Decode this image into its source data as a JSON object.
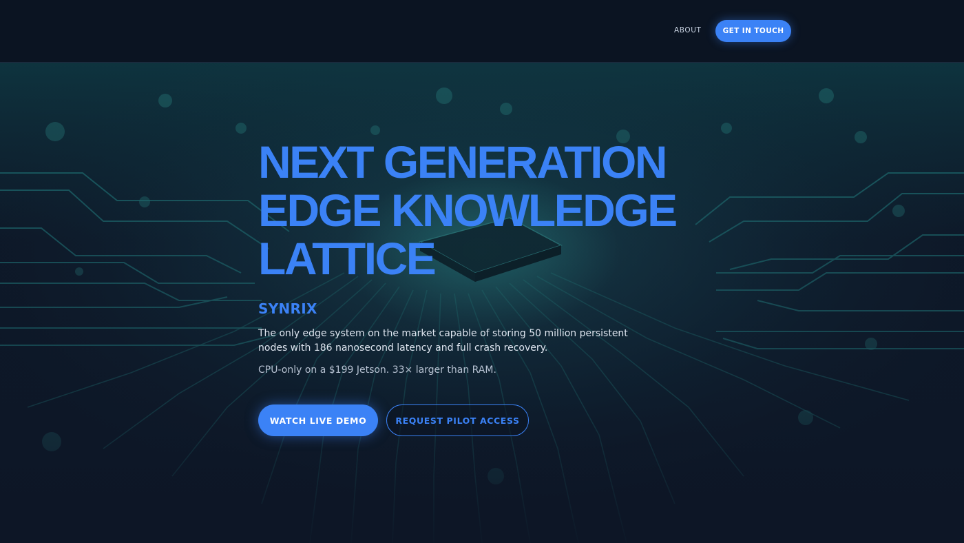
{
  "nav": {
    "about_label": "ABOUT",
    "cta_label": "GET IN TOUCH"
  },
  "hero": {
    "headline_lines": [
      "NEXT GENERATION",
      "EDGE KNOWLEDGE",
      "LATTICE"
    ],
    "brand": "SYNRIX",
    "description": "The only edge system on the market capable of storing 50 million persistent nodes with 186 nanosecond latency and full crash recovery.",
    "subtext": "CPU-only on a $199 Jetson. 33× larger than RAM.",
    "primary_button": "WATCH LIVE DEMO",
    "secondary_button": "REQUEST PILOT ACCESS"
  },
  "colors": {
    "accent": "#3b82f6",
    "background": "#0d1626",
    "circuit": "#1f6f73"
  },
  "icons": {
    "hero_background": "circuit-board-chip-image"
  }
}
